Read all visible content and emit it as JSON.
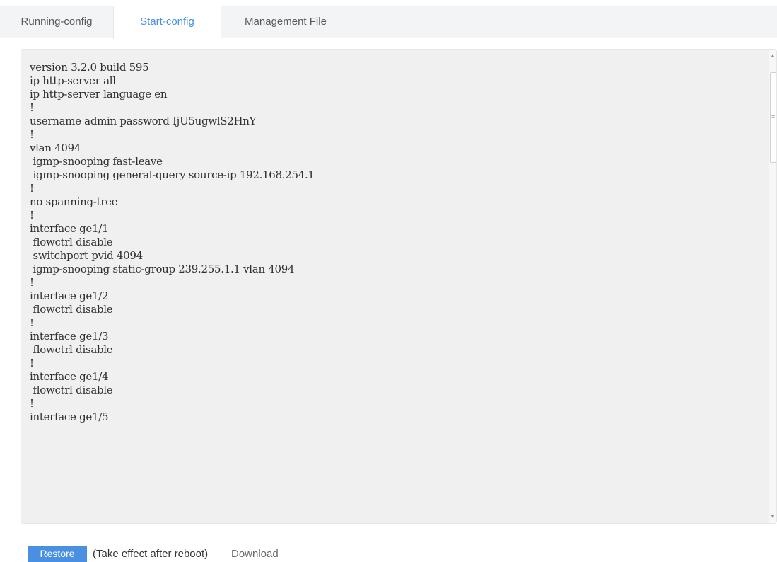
{
  "tabs": [
    {
      "label": "Running-config",
      "active": false
    },
    {
      "label": "Start-config",
      "active": true
    },
    {
      "label": "Management File",
      "active": false
    }
  ],
  "config_lines": [
    "version 3.2.0 build 595",
    "ip http-server all",
    "ip http-server language en",
    "!",
    "username admin password IjU5ugwlS2HnY",
    "!",
    "vlan 4094",
    " igmp-snooping fast-leave",
    " igmp-snooping general-query source-ip 192.168.254.1",
    "!",
    "no spanning-tree",
    "!",
    "interface ge1/1",
    " flowctrl disable",
    " switchport pvid 4094",
    " igmp-snooping static-group 239.255.1.1 vlan 4094",
    "!",
    "interface ge1/2",
    " flowctrl disable",
    "!",
    "interface ge1/3",
    " flowctrl disable",
    "!",
    "interface ge1/4",
    " flowctrl disable",
    "!",
    "interface ge1/5"
  ],
  "actions": {
    "restore_label": "Restore",
    "hint": "(Take effect after reboot)",
    "download_label": "Download"
  },
  "colors": {
    "accent": "#4a90e2",
    "editor_bg": "#f0f0f0",
    "tabbar_bg": "#f2f4f6"
  },
  "icons": {
    "scroll_up": "triangle-up",
    "scroll_down": "triangle-down",
    "grip": "three-bars"
  }
}
